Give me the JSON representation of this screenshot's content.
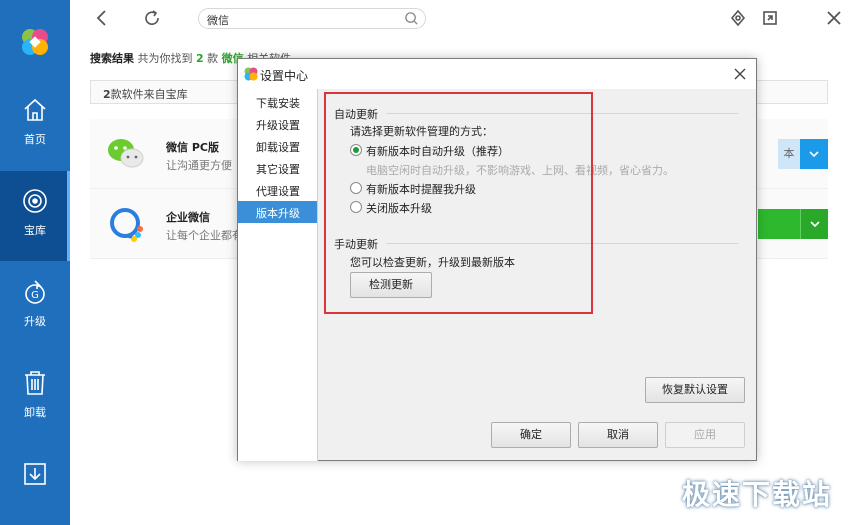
{
  "sidebar": {
    "items": [
      {
        "label": "首页",
        "icon": "home-icon"
      },
      {
        "label": "宝库",
        "icon": "disc-icon"
      },
      {
        "label": "升级",
        "icon": "upgrade-icon"
      },
      {
        "label": "卸载",
        "icon": "trash-icon"
      },
      {
        "label": "",
        "icon": "download-icon"
      }
    ],
    "active_index": 1,
    "bg_color": "#1f6fbd",
    "active_color": "#0e4f93"
  },
  "search": {
    "value": "微信"
  },
  "results": {
    "title": "搜索结果",
    "prefix": "共为你找到",
    "count": "2",
    "unit": "款",
    "keyword": "微信",
    "suffix": "相关软件"
  },
  "source_bar": {
    "count": "2",
    "text": "款软件来自宝库"
  },
  "apps": [
    {
      "name": "微信 PC版",
      "desc": "让沟通更方便",
      "button_fragment": "本"
    },
    {
      "name": "企业微信",
      "desc": "让每个企业都有"
    }
  ],
  "dialog": {
    "title": "设置中心",
    "nav": [
      "下载安装",
      "升级设置",
      "卸载设置",
      "其它设置",
      "代理设置",
      "版本升级"
    ],
    "active_nav_index": 5,
    "auto_update": {
      "heading": "自动更新",
      "prompt": "请选择更新软件管理的方式：",
      "options": [
        {
          "label": "有新版本时自动升级（推荐）",
          "checked": true
        },
        {
          "label": "有新版本时提醒我升级",
          "checked": false
        },
        {
          "label": "关闭版本升级",
          "checked": false
        }
      ],
      "hint": "电脑空闲时自动升级，不影响游戏、上网、看视频，省心省力。"
    },
    "manual_update": {
      "heading": "手动更新",
      "desc": "您可以检查更新，升级到最新版本",
      "button": "检测更新"
    },
    "restore_button": "恢复默认设置",
    "ok_button": "确定",
    "cancel_button": "取消",
    "apply_button": "应用"
  },
  "watermark": "极速下载站"
}
